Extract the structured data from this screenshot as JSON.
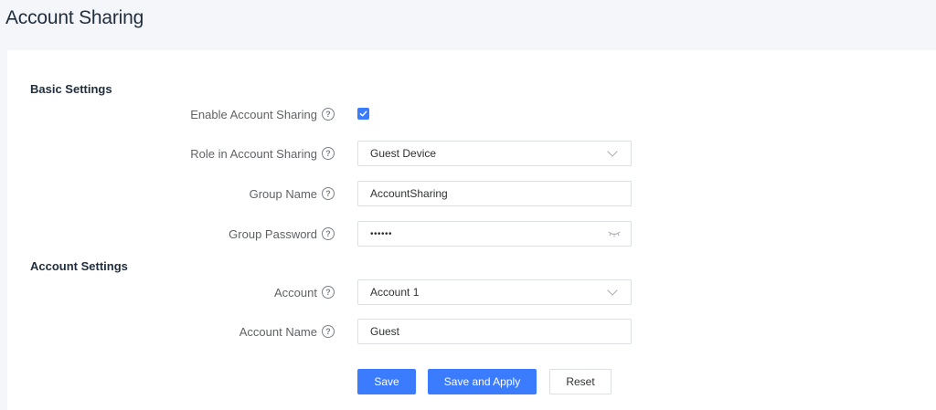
{
  "page": {
    "title": "Account Sharing"
  },
  "basic": {
    "title": "Basic Settings",
    "enable": {
      "label": "Enable Account Sharing",
      "checked": true
    },
    "role": {
      "label": "Role in Account Sharing",
      "value": "Guest Device"
    },
    "group_name": {
      "label": "Group Name",
      "value": "AccountSharing"
    },
    "group_password": {
      "label": "Group Password",
      "value": "••••••"
    }
  },
  "account": {
    "title": "Account Settings",
    "account": {
      "label": "Account",
      "value": "Account 1"
    },
    "account_name": {
      "label": "Account Name",
      "value": "Guest"
    }
  },
  "buttons": {
    "save": "Save",
    "save_apply": "Save and Apply",
    "reset": "Reset"
  },
  "colors": {
    "accent": "#3b7cff"
  },
  "icons": {
    "help": "?",
    "check": "check-icon",
    "dropdown": "chevron-down-icon",
    "password": "eye-closed-icon"
  }
}
